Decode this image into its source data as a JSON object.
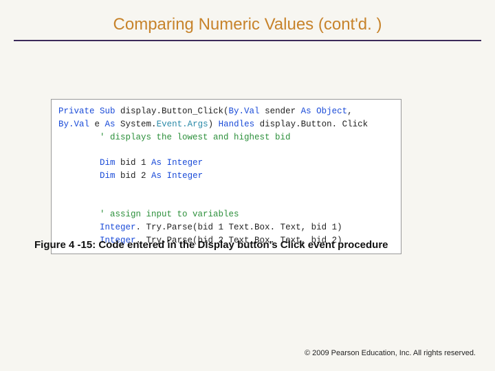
{
  "title": "Comparing Numeric Values (cont'd. )",
  "code": {
    "l1a": "Private Sub",
    "l1b": " display.Button_Click(",
    "l1c": "By.Val",
    "l1d": " sender ",
    "l1e": "As",
    "l1f": " ",
    "l1g": "Object",
    "l1h": ",",
    "l2a": "By.Val",
    "l2b": " e ",
    "l2c": "As",
    "l2d": " System.",
    "l2e": "Event.Args",
    "l2f": ") ",
    "l2g": "Handles",
    "l2h": " display.Button. Click",
    "l3": "        ' displays the lowest and highest bid",
    "blank": " ",
    "l4a": "        ",
    "l4b": "Dim",
    "l4c": " bid 1 ",
    "l4d": "As",
    "l4e": " ",
    "l4f": "Integer",
    "l5a": "        ",
    "l5b": "Dim",
    "l5c": " bid 2 ",
    "l5d": "As",
    "l5e": " ",
    "l5f": "Integer",
    "l6": "        ' assign input to variables",
    "l7a": "        ",
    "l7b": "Integer",
    "l7c": ". Try.Parse(bid 1 Text.Box. Text, bid 1)",
    "l8a": "        ",
    "l8b": "Integer",
    "l8c": ". Try.Parse(bid 2 Text.Box. Text, bid 2)"
  },
  "caption": "Figure 4 -15: Code entered in the Display button's Click event procedure",
  "footer": "© 2009 Pearson Education, Inc.  All rights reserved."
}
